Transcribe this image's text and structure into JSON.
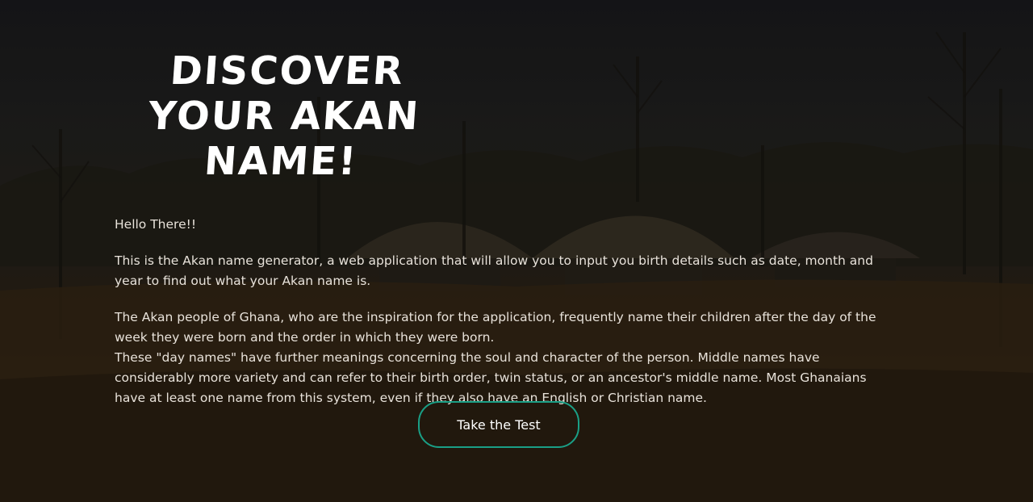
{
  "hero": {
    "title": "Discover Your Akan Name!",
    "greeting": "Hello There!!",
    "intro": "This is the Akan name generator, a web application that will allow you to input you birth details such as date, month and year to find out what your Akan name is.",
    "history_line1": "The Akan people of Ghana, who are the inspiration for the application, frequently name their children after the day of the week they were born and the order in which they were born.",
    "history_line2": "These \"day names\" have further meanings concerning the soul and character of the person. Middle names have considerably more variety and can refer to their birth order, twin status, or an ancestor's middle name. Most Ghanaians have at least one name from this system, even if they also have an English or Christian name.",
    "cta_label": "Take the Test"
  },
  "colors": {
    "text": "#ffffff",
    "body_text": "#e8e2da",
    "cta_border": "#1a9f86"
  }
}
